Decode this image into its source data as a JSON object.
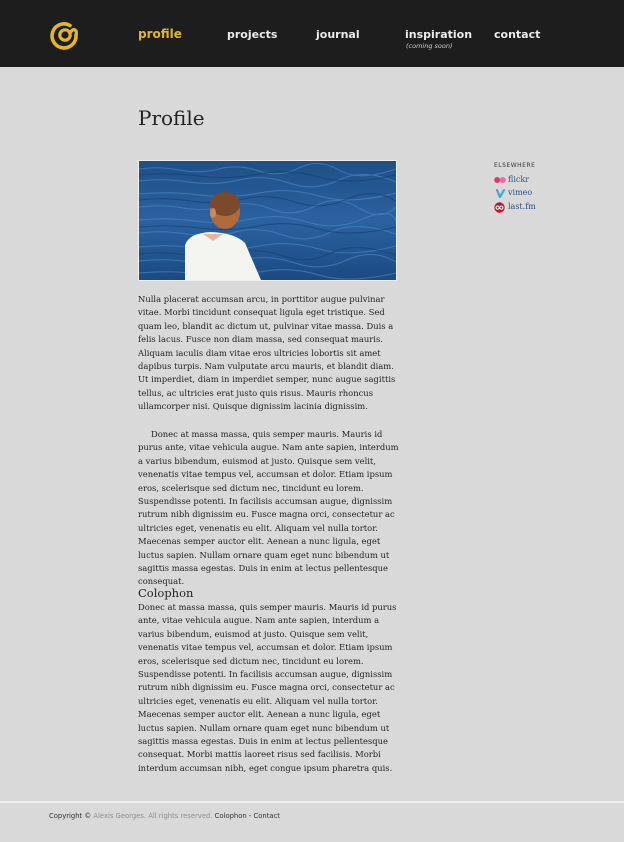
{
  "nav": {
    "profile": "profile",
    "projects": "projects",
    "journal": "journal",
    "inspiration": "inspiration",
    "inspiration_note": "(coming soon)",
    "contact": "contact"
  },
  "main": {
    "title": "Profile",
    "paragraphs": [
      "Nulla placerat accumsan arcu, in porttitor augue pulvinar vitae. Morbi tincidunt consequat ligula eget tristique. Sed quam leo, blandit ac dictum ut, pulvinar vitae massa. Duis a felis lacus. Fusce non diam massa, sed consequat mauris. Aliquam iaculis diam vitae eros ultricies lobortis sit amet dapibus turpis. Nam vulputate arcu mauris, et blandit diam. Ut imperdiet, diam in imperdiet semper, nunc augue sagittis tellus, ac ultricies erat justo quis risus. Mauris rhoncus ullamcorper nisi. Quisque dignissim lacinia dignissim.",
      "Donec at massa massa, quis semper mauris. Mauris id purus ante, vitae vehicula augue. Nam ante sapien, interdum a varius bibendum, euismod at justo. Quisque sem velit, venenatis vitae tempus vel, accumsan et dolor. Etiam ipsum eros, scelerisque sed dictum nec, tincidunt eu lorem. Suspendisse potenti. In facilisis accumsan augue, dignissim rutrum nibh dignissim eu. Fusce magna orci, consectetur ac ultricies eget, venenatis eu elit. Aliquam vel nulla tortor. Maecenas semper auctor elit. Aenean a nunc ligula, eget luctus sapien. Nullam ornare quam eget nunc bibendum ut sagittis massa egestas. Duis in enim at lectus pellentesque consequat."
    ],
    "colophon_title": "Colophon",
    "colophon_text": "Donec at massa massa, quis semper mauris. Mauris id purus ante, vitae vehicula augue. Nam ante sapien, interdum a varius bibendum, euismod at justo. Quisque sem velit, venenatis vitae tempus vel, accumsan et dolor. Etiam ipsum eros, scelerisque sed dictum nec, tincidunt eu lorem. Suspendisse potenti. In facilisis accumsan augue, dignissim rutrum nibh dignissim eu. Fusce magna orci, consectetur ac ultricies eget, venenatis eu elit. Aliquam vel nulla tortor. Maecenas semper auctor elit. Aenean a nunc ligula, eget luctus sapien. Nullam ornare quam eget nunc bibendum ut sagittis massa egestas. Duis in enim at lectus pellentesque consequat. Morbi mattis laoreet risus sed facilisis. Morbi interdum accumsan nibh, eget congue ipsum pharetra quis."
  },
  "elsewhere": {
    "heading": "ELSEWHERE",
    "links": [
      {
        "label": "flickr",
        "icon": "flickr-icon"
      },
      {
        "label": "vimeo",
        "icon": "vimeo-icon"
      },
      {
        "label": "last.fm",
        "icon": "lastfm-icon"
      }
    ]
  },
  "footer": {
    "copyright": "Copyright ©",
    "owner": "Alexis Georges. All rights reserved.",
    "colophon_link": "Colophon",
    "separator": "-",
    "contact_link": "Contact"
  },
  "colors": {
    "header_bg": "#1d1d1d",
    "accent": "#e3b52a",
    "page_bg": "#d9d9d9",
    "link": "#2d4f86"
  }
}
